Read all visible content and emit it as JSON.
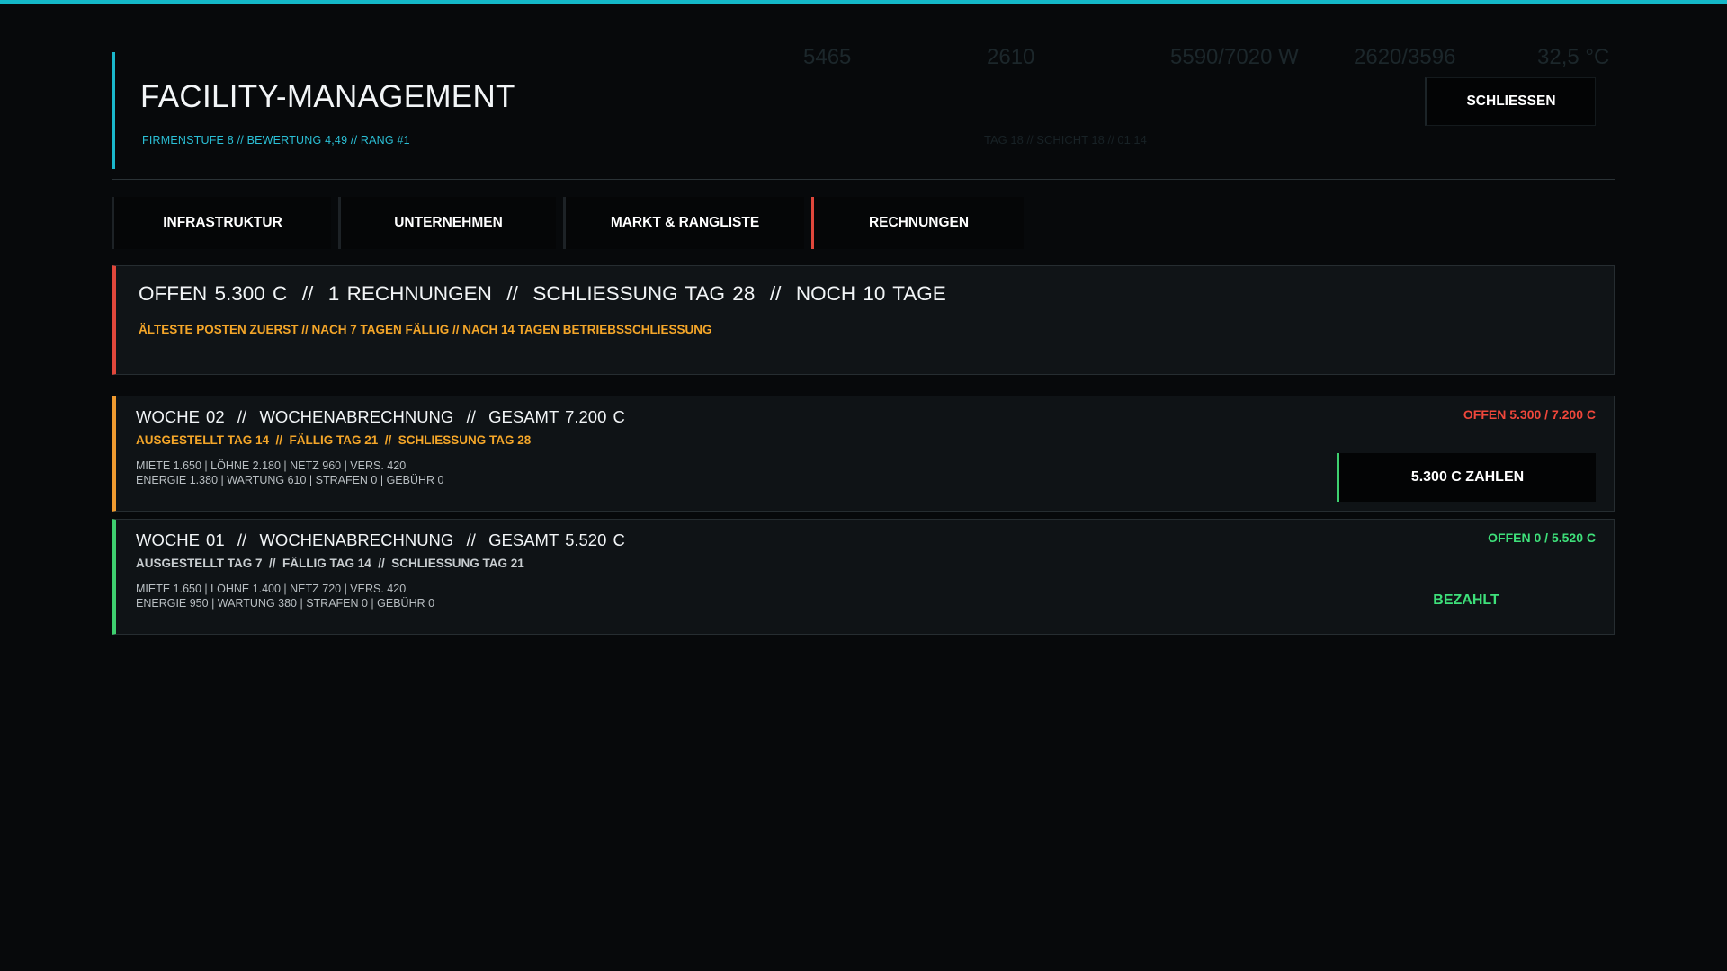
{
  "background": {
    "stats": [
      {
        "value": "5465"
      },
      {
        "value": "2610"
      },
      {
        "value": "5590/7020 W"
      },
      {
        "value": "2620/3596"
      },
      {
        "value": "32,5 °C"
      }
    ],
    "day_line": "TAG 18 // SCHICHT 18 // 01:14"
  },
  "header": {
    "title": "FACILITY-MANAGEMENT",
    "subtitle": "FIRMENSTUFE 8 // BEWERTUNG 4,49 // RANG #1",
    "close_label": "SCHLIESSEN",
    "accent_color": "#1ab7cc"
  },
  "tabs": [
    {
      "label": "INFRASTRUKTUR",
      "active": false
    },
    {
      "label": "UNTERNEHMEN",
      "active": false
    },
    {
      "label": "MARKT & RANGLISTE",
      "active": false
    },
    {
      "label": "RECHNUNGEN",
      "active": true
    }
  ],
  "summary": {
    "title": "OFFEN 5.300 C  //  1 RECHNUNGEN  //  SCHLIESSUNG TAG 28  //  NOCH 10 TAGE",
    "subtitle": "ÄLTESTE POSTEN ZUERST // NACH 7 TAGEN FÄLLIG // NACH 14 TAGEN BETRIEBSSCHLIESSUNG",
    "accent_color": "#e0473b"
  },
  "invoices": [
    {
      "title": "WOCHE 02  //  WOCHENABRECHNUNG  //  GESAMT 7.200 C",
      "meta": "AUSGESTELLT TAG 14  //  FÄLLIG TAG 21  //  SCHLIESSUNG TAG 28",
      "line1": "MIETE 1.650 | LÖHNE 2.180 | NETZ 960 | VERS. 420",
      "line2": "ENERGIE 1.380 | WARTUNG 610 | STRAFEN 0 | GEBÜHR 0",
      "status": "OFFEN 5.300 / 7.200 C",
      "action": "5.300 C ZAHLEN",
      "accent_color": "#ef9a30"
    },
    {
      "title": "WOCHE 01  //  WOCHENABRECHNUNG  //  GESAMT 5.520 C",
      "meta": "AUSGESTELLT TAG 7  //  FÄLLIG TAG 14  //  SCHLIESSUNG TAG 21",
      "line1": "MIETE 1.650 | LÖHNE 1.400 | NETZ 720 | VERS. 420",
      "line2": "ENERGIE 950 | WARTUNG 380 | STRAFEN 0 | GEBÜHR 0",
      "status": "OFFEN 0 / 5.520 C",
      "paid_label": "BEZAHLT",
      "accent_color": "#3ecf6f"
    }
  ]
}
